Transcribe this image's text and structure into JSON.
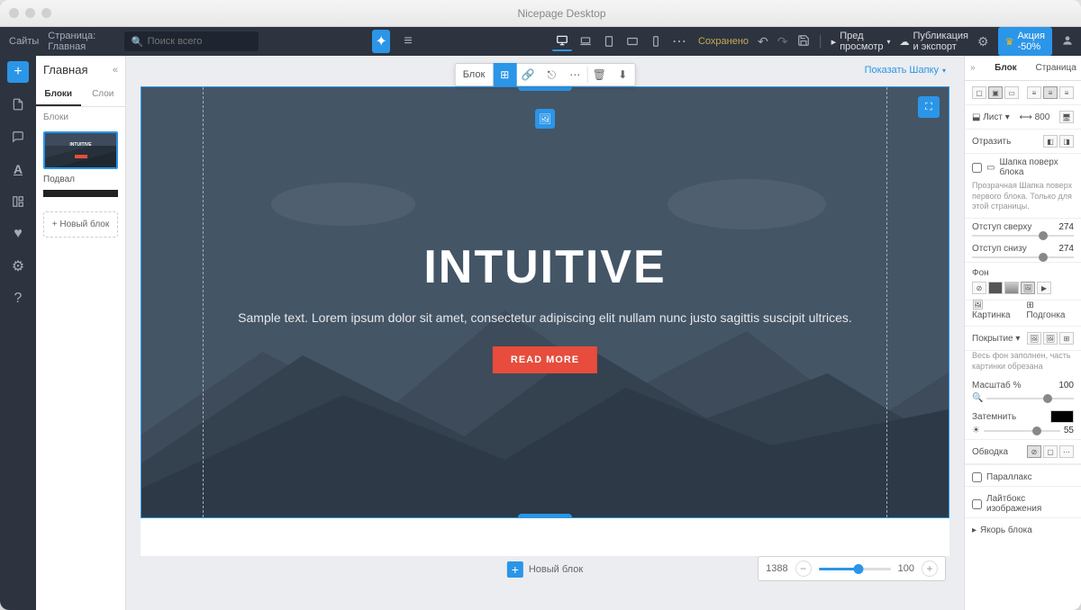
{
  "app_title": "Nicepage Desktop",
  "topbar": {
    "sites": "Сайты",
    "page_crumb": "Страница: Главная",
    "search_placeholder": "Поиск всего",
    "saved": "Сохранено",
    "preview": "Пред просмотр",
    "publish": "Публикация и экспорт",
    "promo": "Акция -50%"
  },
  "leftpanel": {
    "title": "Главная",
    "tab_blocks": "Блоки",
    "tab_layers": "Слои",
    "section_blocks": "Блоки",
    "thumb_text": "INTUITIVE",
    "footer_label": "Подвал",
    "new_block": "+ Новый блок"
  },
  "canvas": {
    "show_header": "Показать Шапку",
    "block_label": "Блок",
    "hero_title": "INTUITIVE",
    "hero_text": "Sample text. Lorem ipsum dolor sit amet, consectetur adipiscing elit nullam nunc justo sagittis suscipit ultrices.",
    "hero_button": "READ MORE",
    "new_block": "Новый блок",
    "zoom_width": "1388",
    "zoom_percent": "100"
  },
  "rightpanel": {
    "tab_block": "Блок",
    "tab_page": "Страница",
    "sheet": "Лист",
    "width": "800",
    "reflect": "Отразить",
    "header_over": "Шапка поверх блока",
    "header_note": "Прозрачная Шапка поверх первого блока. Только для этой страницы.",
    "pad_top": "Отступ сверху",
    "pad_top_val": "274",
    "pad_bot": "Отступ снизу",
    "pad_bot_val": "274",
    "bg": "Фон",
    "bg_image": "Картинка",
    "bg_fit": "Подгонка",
    "cover": "Покрытие",
    "cover_note": "Весь фон заполнен, часть картинки обрезана",
    "scale": "Масштаб %",
    "scale_val": "100",
    "darken": "Затемнить",
    "darken_val": "55",
    "stroke": "Обводка",
    "parallax": "Параллакс",
    "lightbox": "Лайтбокс изображения",
    "anchor": "Якорь блока"
  }
}
